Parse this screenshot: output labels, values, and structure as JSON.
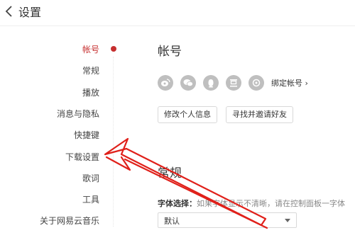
{
  "header": {
    "title": "设置"
  },
  "sidebar": {
    "items": [
      {
        "label": "帐号",
        "active": true
      },
      {
        "label": "常规",
        "active": false
      },
      {
        "label": "播放",
        "active": false
      },
      {
        "label": "消息与隐私",
        "active": false
      },
      {
        "label": "快捷键",
        "active": false
      },
      {
        "label": "下载设置",
        "active": false
      },
      {
        "label": "歌词",
        "active": false
      },
      {
        "label": "工具",
        "active": false
      },
      {
        "label": "关于网易云音乐",
        "active": false
      }
    ]
  },
  "account": {
    "title": "帐号",
    "social_icons": [
      "weibo-icon",
      "wechat-icon",
      "qq-icon",
      "douban-icon",
      "renren-icon"
    ],
    "bind_label": "绑定帐号 ›",
    "edit_profile_label": "修改个人信息",
    "find_friends_label": "寻找并邀请好友"
  },
  "general": {
    "title": "常规",
    "font_label": "字体选择：",
    "font_hint": "如果字体显示不清晰，请在控制面板一字体",
    "font_value": "默认"
  },
  "annotation": {
    "arrow_color": "#e0201a"
  }
}
